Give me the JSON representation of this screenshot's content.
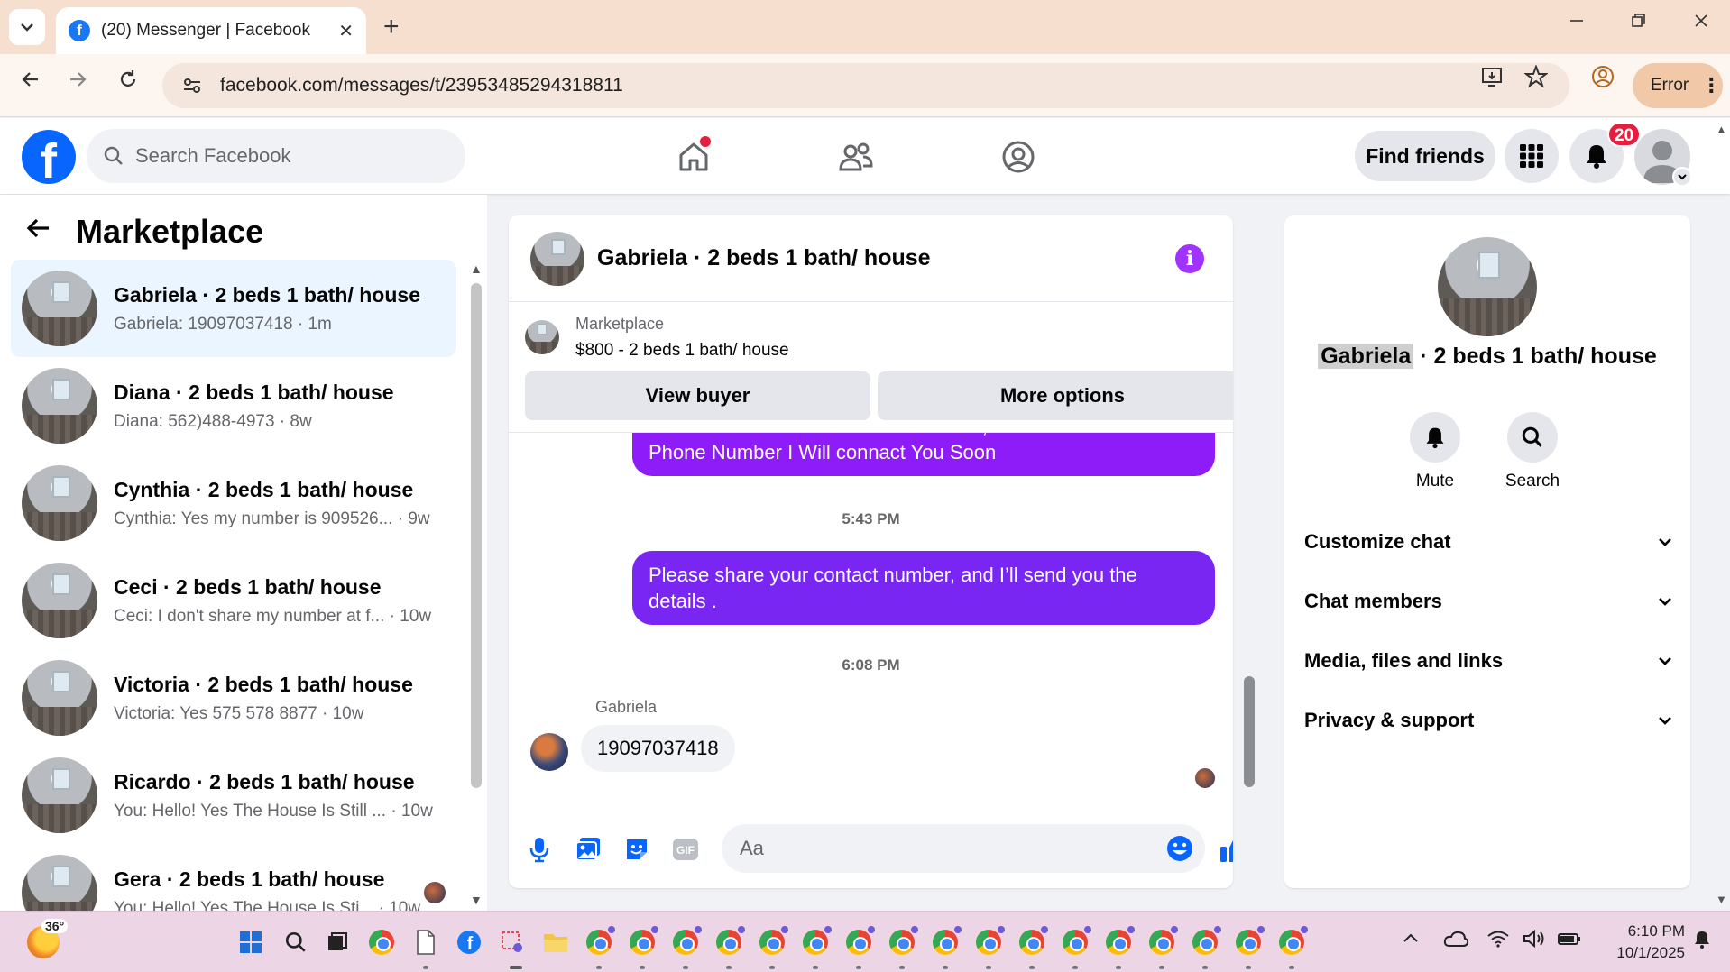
{
  "browser": {
    "tab_title": "(20) Messenger | Facebook",
    "url": "facebook.com/messages/t/23953485294318811",
    "profile_status": "Error",
    "new_tab_glyph": "+",
    "close_glyph": "✕"
  },
  "fb_header": {
    "logo": "f",
    "search_placeholder": "Search Facebook",
    "find_friends_label": "Find friends",
    "notification_count": "20"
  },
  "sidebar": {
    "title": "Marketplace",
    "conversations": [
      {
        "name": "Gabriela · 2 beds 1 bath/ house",
        "preview": "Gabriela: 19097037418 · 1m",
        "active": true
      },
      {
        "name": "Diana · 2 beds 1 bath/ house",
        "preview": "Diana: 562)488-4973 · 8w"
      },
      {
        "name": "Cynthia · 2 beds 1 bath/ house",
        "preview": "Cynthia: Yes my number is 909526... · 9w"
      },
      {
        "name": "Ceci · 2 beds 1 bath/ house",
        "preview": "Ceci: I don't share my number at f... · 10w"
      },
      {
        "name": "Victoria · 2 beds 1 bath/ house",
        "preview": "Victoria: Yes 575 578 8877 · 10w"
      },
      {
        "name": "Ricardo · 2 beds 1 bath/ house",
        "preview": "You: Hello! Yes The House Is Still ... · 10w"
      },
      {
        "name": "Gera · 2 beds 1 bath/ house",
        "preview": "You: Hello! Yes The House Is Sti... · 10w"
      }
    ]
  },
  "chat": {
    "title": "Gabriela · 2 beds 1 bath/ house",
    "listing_label": "Marketplace",
    "listing_price": "$800 - 2 beds 1 bath/ house",
    "view_buyer_label": "View buyer",
    "more_options_label": "More options",
    "messages": {
      "out1": "Hello! Yes The House  Is Still Available, Please Send Your Phone Number I Will connact You Soon",
      "ts1": "5:43 PM",
      "out2": "Please share your contact number, and I’ll send you the details .",
      "ts2": "6:08 PM",
      "sender": "Gabriela",
      "in1": "19097037418"
    },
    "composer_placeholder": "Aa",
    "out_colors": [
      "#8e1cf8",
      "#7a26f2"
    ]
  },
  "info_panel": {
    "name_first": "Gabriela",
    "name_rest": " · 2 beds 1 bath/ house",
    "mute_label": "Mute",
    "search_label": "Search",
    "sections": [
      "Customize chat",
      "Chat members",
      "Media, files and links",
      "Privacy & support"
    ]
  },
  "taskbar": {
    "temperature": "36°",
    "time": "6:10 PM",
    "date": "10/1/2025"
  },
  "colors": {
    "accent_blue": "#0866ff",
    "badge_red": "#e41e3f",
    "messenger_purple": "#a033ff"
  }
}
